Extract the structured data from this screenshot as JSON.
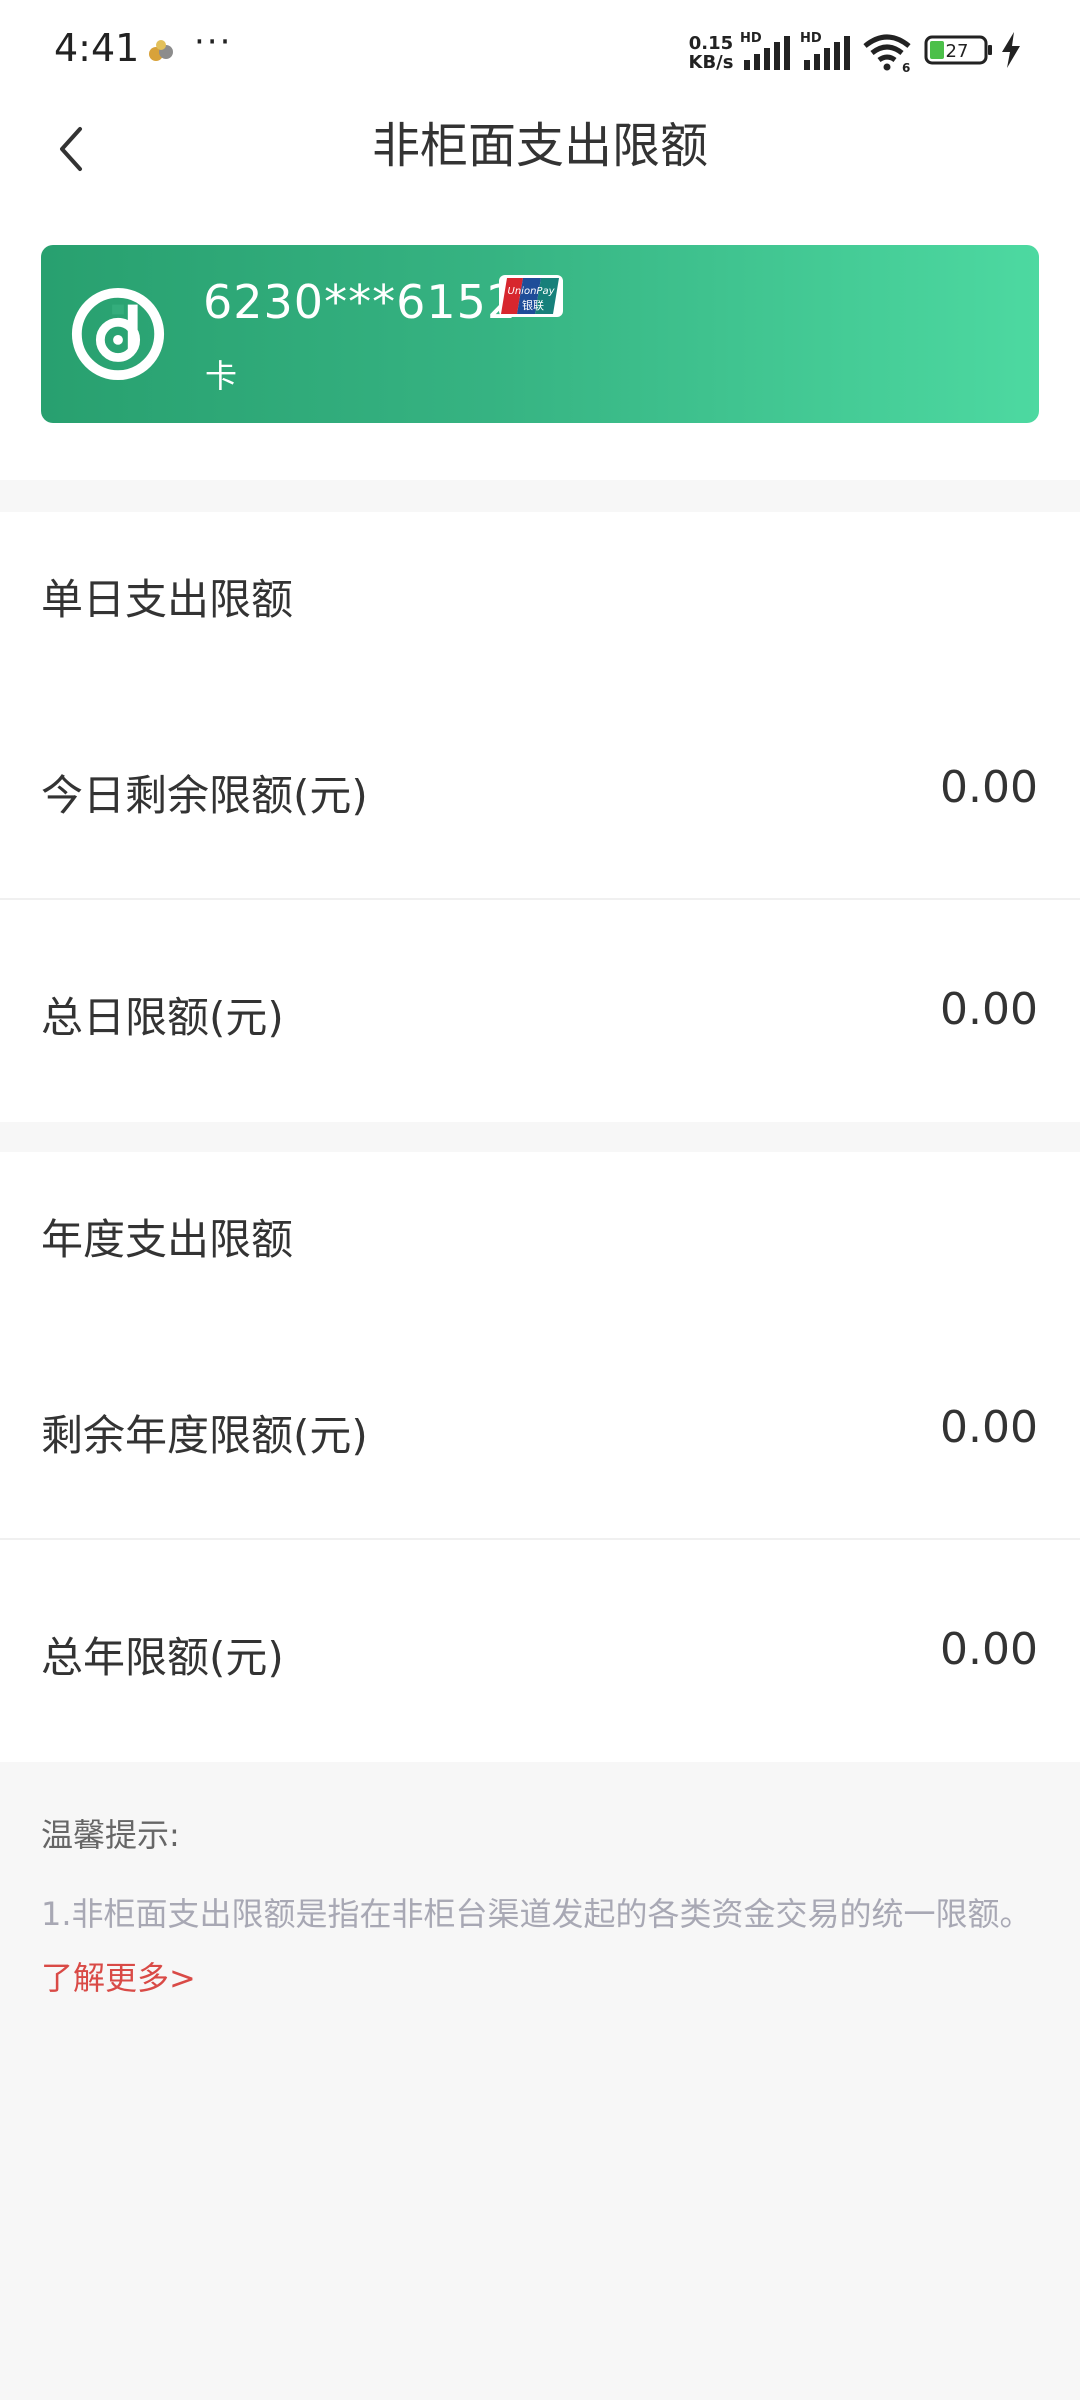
{
  "status_bar": {
    "time": "4:41",
    "more": "···",
    "net_speed_value": "0.15",
    "net_speed_unit": "KB/s",
    "sim1_label": "HD",
    "sim2_label": "HD",
    "wifi_badge": "6",
    "battery_level": "27"
  },
  "nav": {
    "title": "非柜面支出限额"
  },
  "card": {
    "number": "6230***6152",
    "type_label": "卡",
    "unionpay_top": "UnionPay",
    "unionpay_bottom": "银联",
    "colors": {
      "start": "#28a06f",
      "end": "#4dd9a1"
    }
  },
  "daily": {
    "title": "单日支出限额",
    "rows": [
      {
        "label": "今日剩余限额(元)",
        "value": "0.00"
      },
      {
        "label": "总日限额(元)",
        "value": "0.00"
      }
    ]
  },
  "yearly": {
    "title": "年度支出限额",
    "rows": [
      {
        "label": "剩余年度限额(元)",
        "value": "0.00"
      },
      {
        "label": "总年限额(元)",
        "value": "0.00"
      }
    ]
  },
  "tips": {
    "title": "温馨提示:",
    "body": "1.非柜面支出限额是指在非柜台渠道发起的各类资金交易的统一限额。",
    "link": "了解更多>"
  },
  "colors": {
    "accent_link": "#d94a46",
    "page_bg": "#f7f7f7"
  }
}
